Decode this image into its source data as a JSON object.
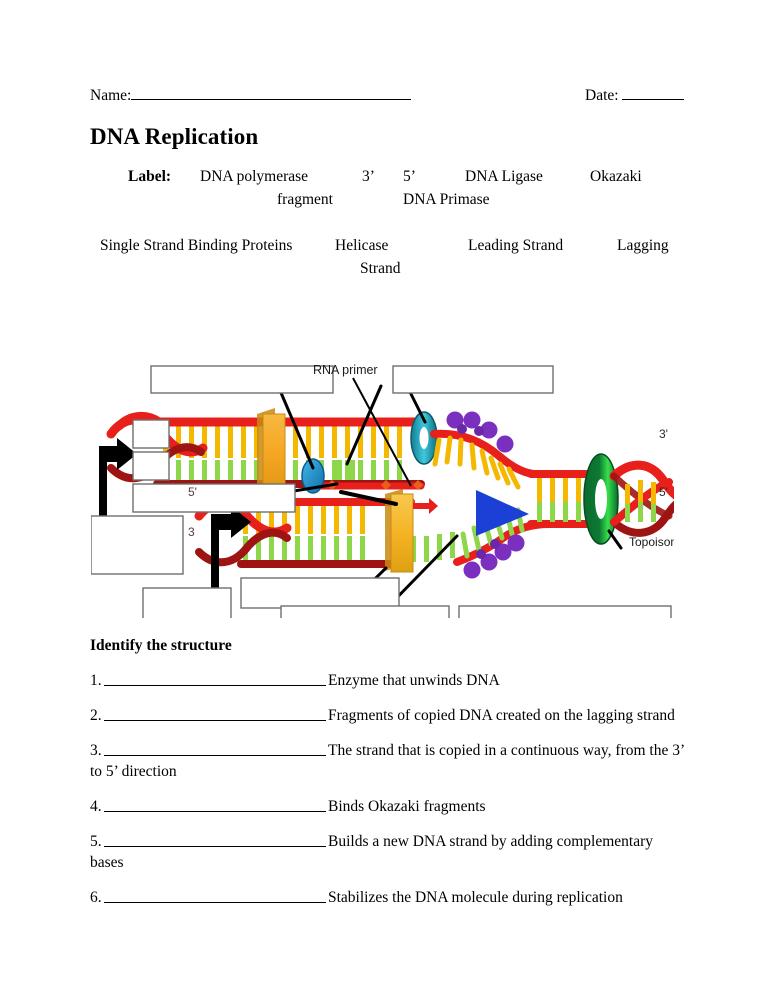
{
  "header": {
    "name_label": "Name:",
    "date_label": "Date:"
  },
  "title": "DNA Replication",
  "label_section": {
    "label_heading": "Label:",
    "terms": [
      "DNA polymerase",
      "3’",
      "5’",
      "DNA Ligase",
      "Okazaki",
      "fragment",
      "DNA Primase",
      "Single Strand Binding Proteins",
      "Helicase",
      "Leading Strand",
      "Lagging",
      "Strand"
    ]
  },
  "diagram": {
    "annotations": [
      {
        "text": "RNA primer"
      },
      {
        "text": "Topoisomerase"
      },
      {
        "text": "3'"
      },
      {
        "text": "5'"
      },
      {
        "text": "5'"
      },
      {
        "text": "3"
      }
    ],
    "blank_boxes_count": 10,
    "colors": {
      "backbone": "#e8201c",
      "backbone_dark": "#9e1412",
      "base_green": "#7ed321",
      "base_green_light": "#a8e063",
      "base_orange": "#f5b800",
      "polymerase_orange": "#f5a623",
      "polymerase_orange_dark": "#e09612",
      "primase_blue": "#2196d4",
      "ligase_teal": "#1aa7bd",
      "ssb_purple": "#7b2fbe",
      "helicase_blue": "#1c3fd6",
      "topoisomerase_green": "#0a6b2e",
      "topoisomerase_green_light": "#35e04a",
      "box_border": "#6e6e6e"
    }
  },
  "identify_heading": "Identify the structure",
  "questions": [
    {
      "num": "1.",
      "desc": "Enzyme that unwinds DNA",
      "cont": ""
    },
    {
      "num": "2.",
      "desc": "Fragments of copied DNA created on the lagging strand",
      "cont": ""
    },
    {
      "num": "3.",
      "desc": "The strand that is copied in a continuous way, from the 3’",
      "cont": "to 5’ direction"
    },
    {
      "num": "4.",
      "desc": "Binds Okazaki fragments",
      "cont": ""
    },
    {
      "num": "5.",
      "desc": "Builds a new DNA strand by adding complementary",
      "cont": "bases"
    },
    {
      "num": "6.",
      "desc": "Stabilizes the DNA molecule during replication",
      "cont": ""
    }
  ]
}
